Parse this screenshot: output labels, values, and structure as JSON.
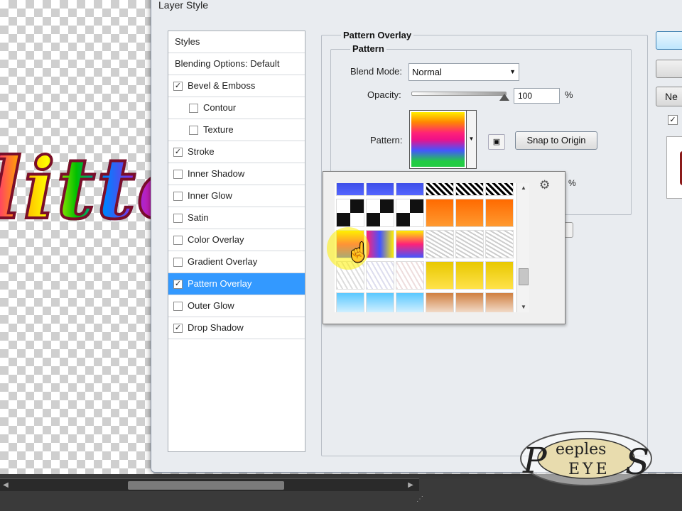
{
  "dialog": {
    "title": "Layer Style"
  },
  "canvas": {
    "glitter_text": "litte"
  },
  "styles_panel": {
    "header": "Styles",
    "blending_options": "Blending Options: Default",
    "items": [
      {
        "label": "Bevel & Emboss",
        "checked": true
      },
      {
        "label": "Contour",
        "checked": false,
        "indent": true
      },
      {
        "label": "Texture",
        "checked": false,
        "indent": true
      },
      {
        "label": "Stroke",
        "checked": true
      },
      {
        "label": "Inner Shadow",
        "checked": false
      },
      {
        "label": "Inner Glow",
        "checked": false
      },
      {
        "label": "Satin",
        "checked": false
      },
      {
        "label": "Color Overlay",
        "checked": false
      },
      {
        "label": "Gradient Overlay",
        "checked": false
      },
      {
        "label": "Pattern Overlay",
        "checked": true,
        "selected": true
      },
      {
        "label": "Outer Glow",
        "checked": false
      },
      {
        "label": "Drop Shadow",
        "checked": true
      }
    ]
  },
  "pattern_overlay": {
    "title": "Pattern Overlay",
    "group_title": "Pattern",
    "blend_mode_label": "Blend Mode:",
    "blend_mode_value": "Normal",
    "opacity_label": "Opacity:",
    "opacity_value": "100",
    "opacity_level": 1.0,
    "percent": "%",
    "pattern_label": "Pattern:",
    "snap_button": "Snap to Origin"
  },
  "right_buttons": {
    "new_style_partial": "Ne"
  },
  "logo": {
    "text_top": "eeples",
    "text_bottom": "EYE",
    "initial_left": "P",
    "initial_right": "S"
  },
  "colors": {
    "selection": "#3399ff",
    "dialog_bg": "#e9ecf0"
  }
}
